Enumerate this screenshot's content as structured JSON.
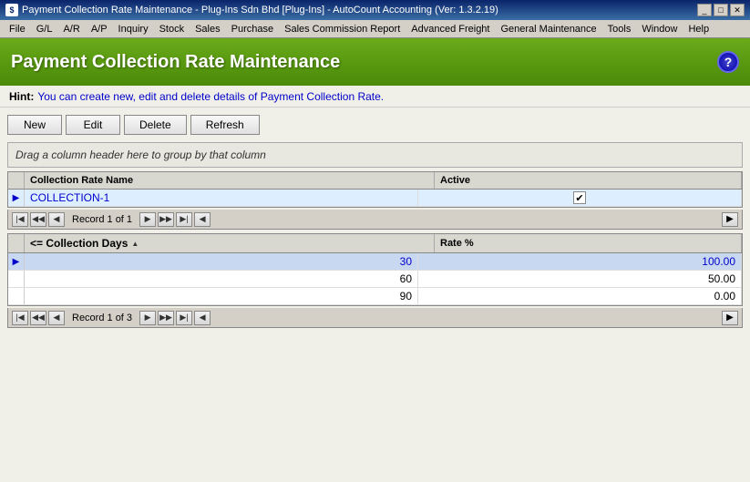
{
  "titleBar": {
    "text": "Payment Collection Rate Maintenance - Plug-Ins Sdn Bhd [Plug-Ins] - AutoCount Accounting (Ver: 1.3.2.19)",
    "icon": "₱",
    "controls": [
      "_",
      "□",
      "✕"
    ]
  },
  "menuBar": {
    "items": [
      "File",
      "G/L",
      "A/R",
      "A/P",
      "Inquiry",
      "Stock",
      "Sales",
      "Purchase",
      "Sales Commission Report",
      "Advanced Freight",
      "General Maintenance",
      "Tools",
      "Window",
      "Help"
    ]
  },
  "header": {
    "title": "Payment Collection Rate Maintenance",
    "helpLabel": "?"
  },
  "hint": {
    "label": "Hint:",
    "text": "You can create new, edit and delete details of Payment Collection Rate."
  },
  "toolbar": {
    "new": "New",
    "edit": "Edit",
    "delete": "Delete",
    "refresh": "Refresh"
  },
  "groupPanel": {
    "text": "Drag a column header here to group by that column"
  },
  "table1": {
    "columns": [
      {
        "id": "name",
        "label": "Collection Rate Name"
      },
      {
        "id": "active",
        "label": "Active"
      }
    ],
    "rows": [
      {
        "name": "COLLECTION-1",
        "active": true,
        "selected": true
      }
    ],
    "navigation": {
      "recordText": "Record 1 of 1"
    }
  },
  "table2": {
    "columns": [
      {
        "id": "days",
        "label": "<= Collection Days",
        "sortable": true
      },
      {
        "id": "rate",
        "label": "Rate %"
      }
    ],
    "rows": [
      {
        "days": "30",
        "rate": "100.00",
        "highlighted": true,
        "indicator": true
      },
      {
        "days": "60",
        "rate": "50.00",
        "highlighted": false,
        "indicator": false
      },
      {
        "days": "90",
        "rate": "0.00",
        "highlighted": false,
        "indicator": false
      }
    ],
    "navigation": {
      "recordText": "Record 1 of 3"
    }
  }
}
